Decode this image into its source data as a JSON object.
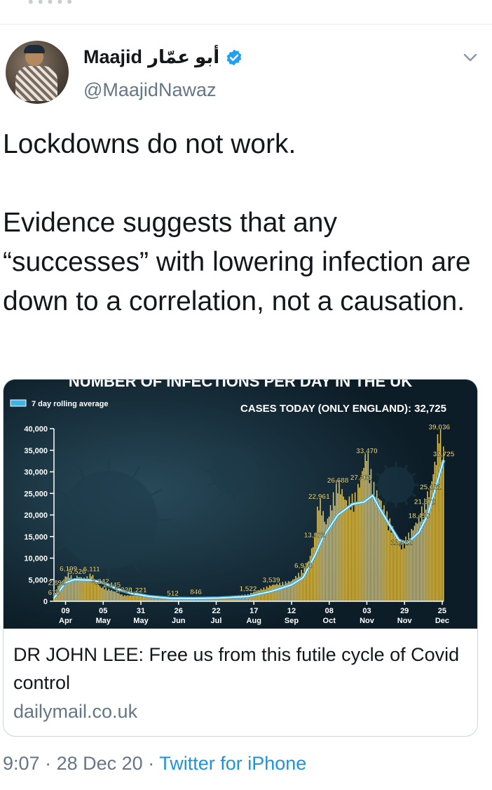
{
  "header_fragment": "• • • • •",
  "author": {
    "name": "Maajid",
    "name_arabic": "أبو عمّار",
    "handle": "@MaajidNawaz",
    "verified": true,
    "avatar_icon": "avatar-photo-icon"
  },
  "tweet": {
    "paragraphs": [
      "Lockdowns do not work.",
      "Evidence suggests that any “successes” with lowering infection are down to a correlation, not a causation."
    ]
  },
  "card": {
    "title": "DR JOHN LEE: Free us from this futile cycle of Covid control",
    "domain": "dailymail.co.uk"
  },
  "meta": {
    "time": "9:07",
    "separator": "·",
    "date": "28 Dec 20",
    "source": "Twitter for iPhone"
  },
  "colors": {
    "accent": "#1b95e0",
    "verified": "#1da1f2",
    "secondary_text": "#657786",
    "chart_bg": "#0f2430",
    "bars": "#e0c35a",
    "line": "#3fb3e6"
  },
  "chart_data": {
    "type": "bar",
    "title": "NUMBER OF INFECTIONS PER DAY IN THE UK",
    "legend": "7 day rolling average",
    "subtitle": "CASES TODAY (ONLY ENGLAND): 32,725",
    "ylim": [
      0,
      40000
    ],
    "yticks": [
      0,
      5000,
      10000,
      15000,
      20000,
      25000,
      30000,
      35000,
      40000
    ],
    "ytick_labels": [
      "0",
      "5,000",
      "10,000",
      "15,000",
      "20,000",
      "25,000",
      "30,000",
      "35,000",
      "40,000"
    ],
    "xticks": [
      {
        "day": 8,
        "label": [
          "09",
          "Apr"
        ]
      },
      {
        "day": 34,
        "label": [
          "05",
          "May"
        ]
      },
      {
        "day": 60,
        "label": [
          "31",
          "May"
        ]
      },
      {
        "day": 86,
        "label": [
          "26",
          "Jun"
        ]
      },
      {
        "day": 112,
        "label": [
          "22",
          "Jul"
        ]
      },
      {
        "day": 138,
        "label": [
          "17",
          "Aug"
        ]
      },
      {
        "day": 164,
        "label": [
          "12",
          "Sep"
        ]
      },
      {
        "day": 190,
        "label": [
          "08",
          "Oct"
        ]
      },
      {
        "day": 216,
        "label": [
          "03",
          "Nov"
        ]
      },
      {
        "day": 242,
        "label": [
          "29",
          "Nov"
        ]
      },
      {
        "day": 268,
        "label": [
          "25",
          "Dec"
        ]
      }
    ],
    "daily_cases_keypoints": [
      [
        0,
        676
      ],
      [
        2,
        2890
      ],
      [
        10,
        6199
      ],
      [
        14,
        4800
      ],
      [
        16,
        5526
      ],
      [
        22,
        5000
      ],
      [
        26,
        6111
      ],
      [
        32,
        3242
      ],
      [
        40,
        2445
      ],
      [
        48,
        1326
      ],
      [
        58,
        1221
      ],
      [
        70,
        700
      ],
      [
        82,
        512
      ],
      [
        98,
        846
      ],
      [
        118,
        1000
      ],
      [
        134,
        1522
      ],
      [
        150,
        3539
      ],
      [
        164,
        4500
      ],
      [
        172,
        6914
      ],
      [
        176,
        9000
      ],
      [
        180,
        13972
      ],
      [
        183,
        22961
      ],
      [
        188,
        17000
      ],
      [
        196,
        26688
      ],
      [
        202,
        22000
      ],
      [
        208,
        23000
      ],
      [
        212,
        27301
      ],
      [
        216,
        33470
      ],
      [
        220,
        26000
      ],
      [
        226,
        22000
      ],
      [
        234,
        16000
      ],
      [
        240,
        12282
      ],
      [
        246,
        15000
      ],
      [
        252,
        18450
      ],
      [
        256,
        21672
      ],
      [
        260,
        25161
      ],
      [
        264,
        32000
      ],
      [
        266,
        39036
      ],
      [
        269,
        32725
      ]
    ],
    "rolling_average_keypoints": [
      [
        0,
        700
      ],
      [
        8,
        4300
      ],
      [
        14,
        5000
      ],
      [
        26,
        4900
      ],
      [
        34,
        4300
      ],
      [
        44,
        2800
      ],
      [
        54,
        1800
      ],
      [
        66,
        1100
      ],
      [
        80,
        700
      ],
      [
        96,
        650
      ],
      [
        114,
        750
      ],
      [
        134,
        1100
      ],
      [
        150,
        2300
      ],
      [
        164,
        3800
      ],
      [
        172,
        5500
      ],
      [
        180,
        10500
      ],
      [
        186,
        15000
      ],
      [
        196,
        20000
      ],
      [
        206,
        22500
      ],
      [
        214,
        23000
      ],
      [
        220,
        24500
      ],
      [
        224,
        22000
      ],
      [
        232,
        17500
      ],
      [
        238,
        14200
      ],
      [
        244,
        13500
      ],
      [
        252,
        16000
      ],
      [
        258,
        20000
      ],
      [
        264,
        27000
      ],
      [
        269,
        32725
      ]
    ],
    "annotations": [
      {
        "x": 0,
        "y": 676,
        "label": "676"
      },
      {
        "x": 2,
        "y": 2890,
        "label": "2,890"
      },
      {
        "x": 10,
        "y": 6199,
        "label": "6,199"
      },
      {
        "x": 16,
        "y": 5526,
        "label": "5,526"
      },
      {
        "x": 26,
        "y": 6111,
        "label": "6,111"
      },
      {
        "x": 32,
        "y": 3242,
        "label": "3,242"
      },
      {
        "x": 40,
        "y": 2445,
        "label": "2,445"
      },
      {
        "x": 48,
        "y": 1326,
        "label": "1,326"
      },
      {
        "x": 58,
        "y": 1221,
        "label": "1,221"
      },
      {
        "x": 82,
        "y": 512,
        "label": "512"
      },
      {
        "x": 98,
        "y": 846,
        "label": "846"
      },
      {
        "x": 134,
        "y": 1522,
        "label": "1,522"
      },
      {
        "x": 150,
        "y": 3539,
        "label": "3,539"
      },
      {
        "x": 172,
        "y": 6914,
        "label": "6,914"
      },
      {
        "x": 180,
        "y": 13972,
        "label": "13,972"
      },
      {
        "x": 183,
        "y": 22961,
        "label": "22,961"
      },
      {
        "x": 196,
        "y": 26688,
        "label": "26,688"
      },
      {
        "x": 212,
        "y": 27301,
        "label": "27,301"
      },
      {
        "x": 216,
        "y": 33470,
        "label": "33,470"
      },
      {
        "x": 240,
        "y": 12282,
        "label": "12,282"
      },
      {
        "x": 252,
        "y": 18450,
        "label": "18,450"
      },
      {
        "x": 256,
        "y": 21672,
        "label": "21,672"
      },
      {
        "x": 260,
        "y": 25161,
        "label": "25,161"
      },
      {
        "x": 266,
        "y": 39036,
        "label": "39,036"
      },
      {
        "x": 269,
        "y": 32725,
        "label": "32,725"
      }
    ]
  }
}
